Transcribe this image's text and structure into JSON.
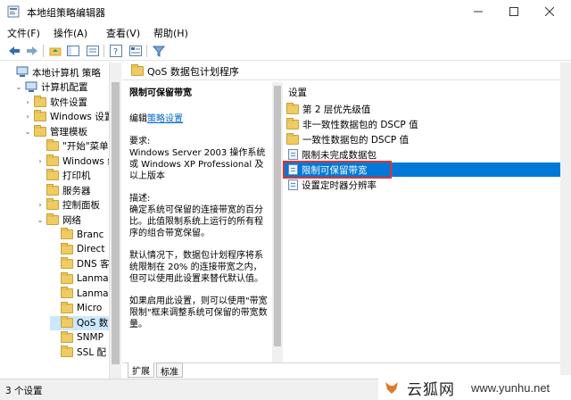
{
  "window": {
    "title": "本地组策略编辑器"
  },
  "menu": [
    "文件(F)",
    "操作(A)",
    "查看(V)",
    "帮助(H)"
  ],
  "tree": [
    {
      "label": "本地计算机 策略",
      "exp": "",
      "icon": "computer-icon"
    },
    {
      "label": "计算机配置",
      "exp": "⌄",
      "icon": "computer-config-icon"
    },
    {
      "label": "软件设置",
      "exp": "›",
      "icon": "folder-icon"
    },
    {
      "label": "Windows 设置",
      "exp": "›",
      "icon": "folder-icon"
    },
    {
      "label": "管理模板",
      "exp": "⌄",
      "icon": "folder-icon"
    },
    {
      "label": "\"开始\"菜单",
      "exp": "",
      "icon": "folder-icon"
    },
    {
      "label": "Windows 组",
      "exp": "›",
      "icon": "folder-icon"
    },
    {
      "label": "打印机",
      "exp": "",
      "icon": "folder-icon"
    },
    {
      "label": "服务器",
      "exp": "",
      "icon": "folder-icon"
    },
    {
      "label": "控制面板",
      "exp": "›",
      "icon": "folder-icon"
    },
    {
      "label": "网络",
      "exp": "⌄",
      "icon": "folder-icon"
    },
    {
      "label": "Branc",
      "exp": "",
      "icon": "folder-icon"
    },
    {
      "label": "Direct",
      "exp": "",
      "icon": "folder-icon"
    },
    {
      "label": "DNS 客",
      "exp": "",
      "icon": "folder-icon"
    },
    {
      "label": "Lanma",
      "exp": "",
      "icon": "folder-icon"
    },
    {
      "label": "Lanma",
      "exp": "",
      "icon": "folder-icon"
    },
    {
      "label": "Micro",
      "exp": "",
      "icon": "folder-icon"
    },
    {
      "label": "QoS 数",
      "exp": "",
      "icon": "folder-icon",
      "selected": true
    },
    {
      "label": "SNMP",
      "exp": "",
      "icon": "folder-icon"
    },
    {
      "label": "SSL 配",
      "exp": "",
      "icon": "folder-icon"
    }
  ],
  "right": {
    "header": "QoS 数据包计划程序",
    "desc_title": "限制可保留带宽",
    "edit_prefix": "编辑",
    "edit_link": "策略设置",
    "req_title": "要求:",
    "req_text": "Windows Server 2003 操作系统\n或 Windows XP Professional 及\n以上版本",
    "desc_label": "描述:",
    "desc_text": "确定系统可保留的连接带宽的百分\n比。此值限制系统上运行的所有程\n序的组合带宽保留。",
    "default_text": "默认情况下，数据包计划程序将系\n统限制在 20% 的连接带宽之内，\n但可以使用此设置来替代默认值。",
    "enable_text": "如果启用此设置，则可以使用\"带宽\n限制\"框来调整系统可保留的带宽数\n量。"
  },
  "settings": {
    "header": "设置",
    "rows": [
      {
        "label": "第 2 层优先级值",
        "icon": "folder-icon"
      },
      {
        "label": "非一致性数据包的 DSCP 值",
        "icon": "folder-icon"
      },
      {
        "label": "一致性数据包的 DSCP 值",
        "icon": "folder-icon"
      },
      {
        "label": "限制未完成数据包",
        "icon": "policy-icon"
      },
      {
        "label": "限制可保留带宽",
        "icon": "policy-icon",
        "selected": true
      },
      {
        "label": "设置定时器分辨率",
        "icon": "policy-icon"
      }
    ]
  },
  "tabs": [
    "扩展",
    "标准"
  ],
  "status": "3 个设置",
  "watermark": {
    "cn": "云狐网",
    "url": "www.yunhu.net"
  },
  "colors": {
    "selection": "#0078d7",
    "highlight_box": "#e03232",
    "link": "#0066cc",
    "folder": "#eecb63"
  }
}
